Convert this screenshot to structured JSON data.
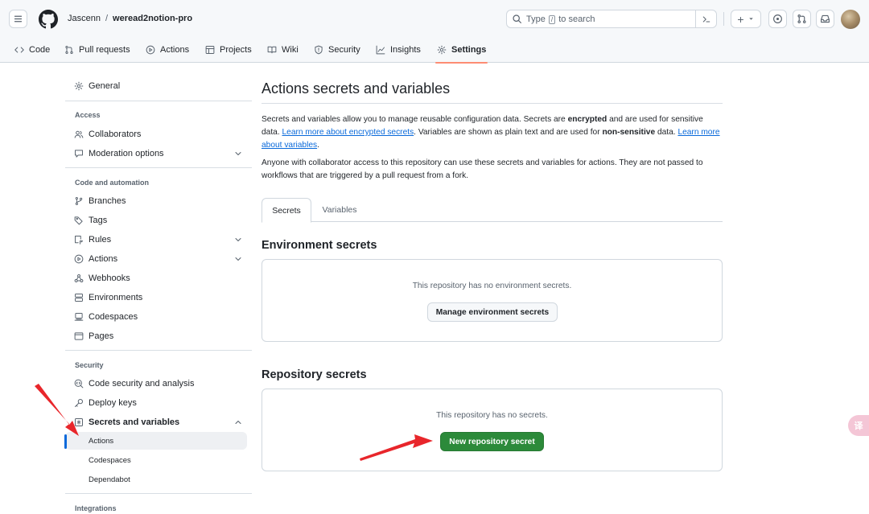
{
  "header": {
    "owner": "Jascenn",
    "separator": "/",
    "repo": "weread2notion-pro",
    "search_prefix": "Type",
    "search_key": "/",
    "search_suffix": "to search",
    "add_label": "+"
  },
  "tabs": [
    {
      "label": "Code",
      "icon": "code-icon"
    },
    {
      "label": "Pull requests",
      "icon": "pull-request-icon"
    },
    {
      "label": "Actions",
      "icon": "play-icon"
    },
    {
      "label": "Projects",
      "icon": "table-icon"
    },
    {
      "label": "Wiki",
      "icon": "book-icon"
    },
    {
      "label": "Security",
      "icon": "shield-icon"
    },
    {
      "label": "Insights",
      "icon": "graph-icon"
    },
    {
      "label": "Settings",
      "icon": "gear-icon"
    }
  ],
  "sidebar": {
    "general": "General",
    "access_heading": "Access",
    "collaborators": "Collaborators",
    "moderation": "Moderation options",
    "code_heading": "Code and automation",
    "branches": "Branches",
    "tags": "Tags",
    "rules": "Rules",
    "actions": "Actions",
    "webhooks": "Webhooks",
    "environments": "Environments",
    "codespaces": "Codespaces",
    "pages": "Pages",
    "security_heading": "Security",
    "code_security": "Code security and analysis",
    "deploy_keys": "Deploy keys",
    "secrets": "Secrets and variables",
    "sub_actions": "Actions",
    "sub_codespaces": "Codespaces",
    "sub_dependabot": "Dependabot",
    "integrations_heading": "Integrations"
  },
  "main": {
    "title": "Actions secrets and variables",
    "p1_a": "Secrets and variables allow you to manage reusable configuration data. Secrets are ",
    "p1_b": "encrypted",
    "p1_c": " and are used for sensitive data. ",
    "p1_link1": "Learn more about encrypted secrets",
    "p1_d": ". Variables are shown as plain text and are used for ",
    "p1_e": "non-sensitive",
    "p1_f": " data. ",
    "p1_link2": "Learn more about variables",
    "p1_g": ".",
    "p2": "Anyone with collaborator access to this repository can use these secrets and variables for actions. They are not passed to workflows that are triggered by a pull request from a fork.",
    "tab_secrets": "Secrets",
    "tab_variables": "Variables",
    "env_heading": "Environment secrets",
    "env_empty": "This repository has no environment secrets.",
    "env_button": "Manage environment secrets",
    "repo_heading": "Repository secrets",
    "repo_empty": "This repository has no secrets.",
    "repo_button": "New repository secret"
  },
  "widget": {
    "translate_label": "译"
  },
  "colors": {
    "primary_button": "#2c8a3a",
    "active_tab_underline": "#fd8c73",
    "link": "#0969da",
    "annotation_arrow": "#e8262b"
  }
}
